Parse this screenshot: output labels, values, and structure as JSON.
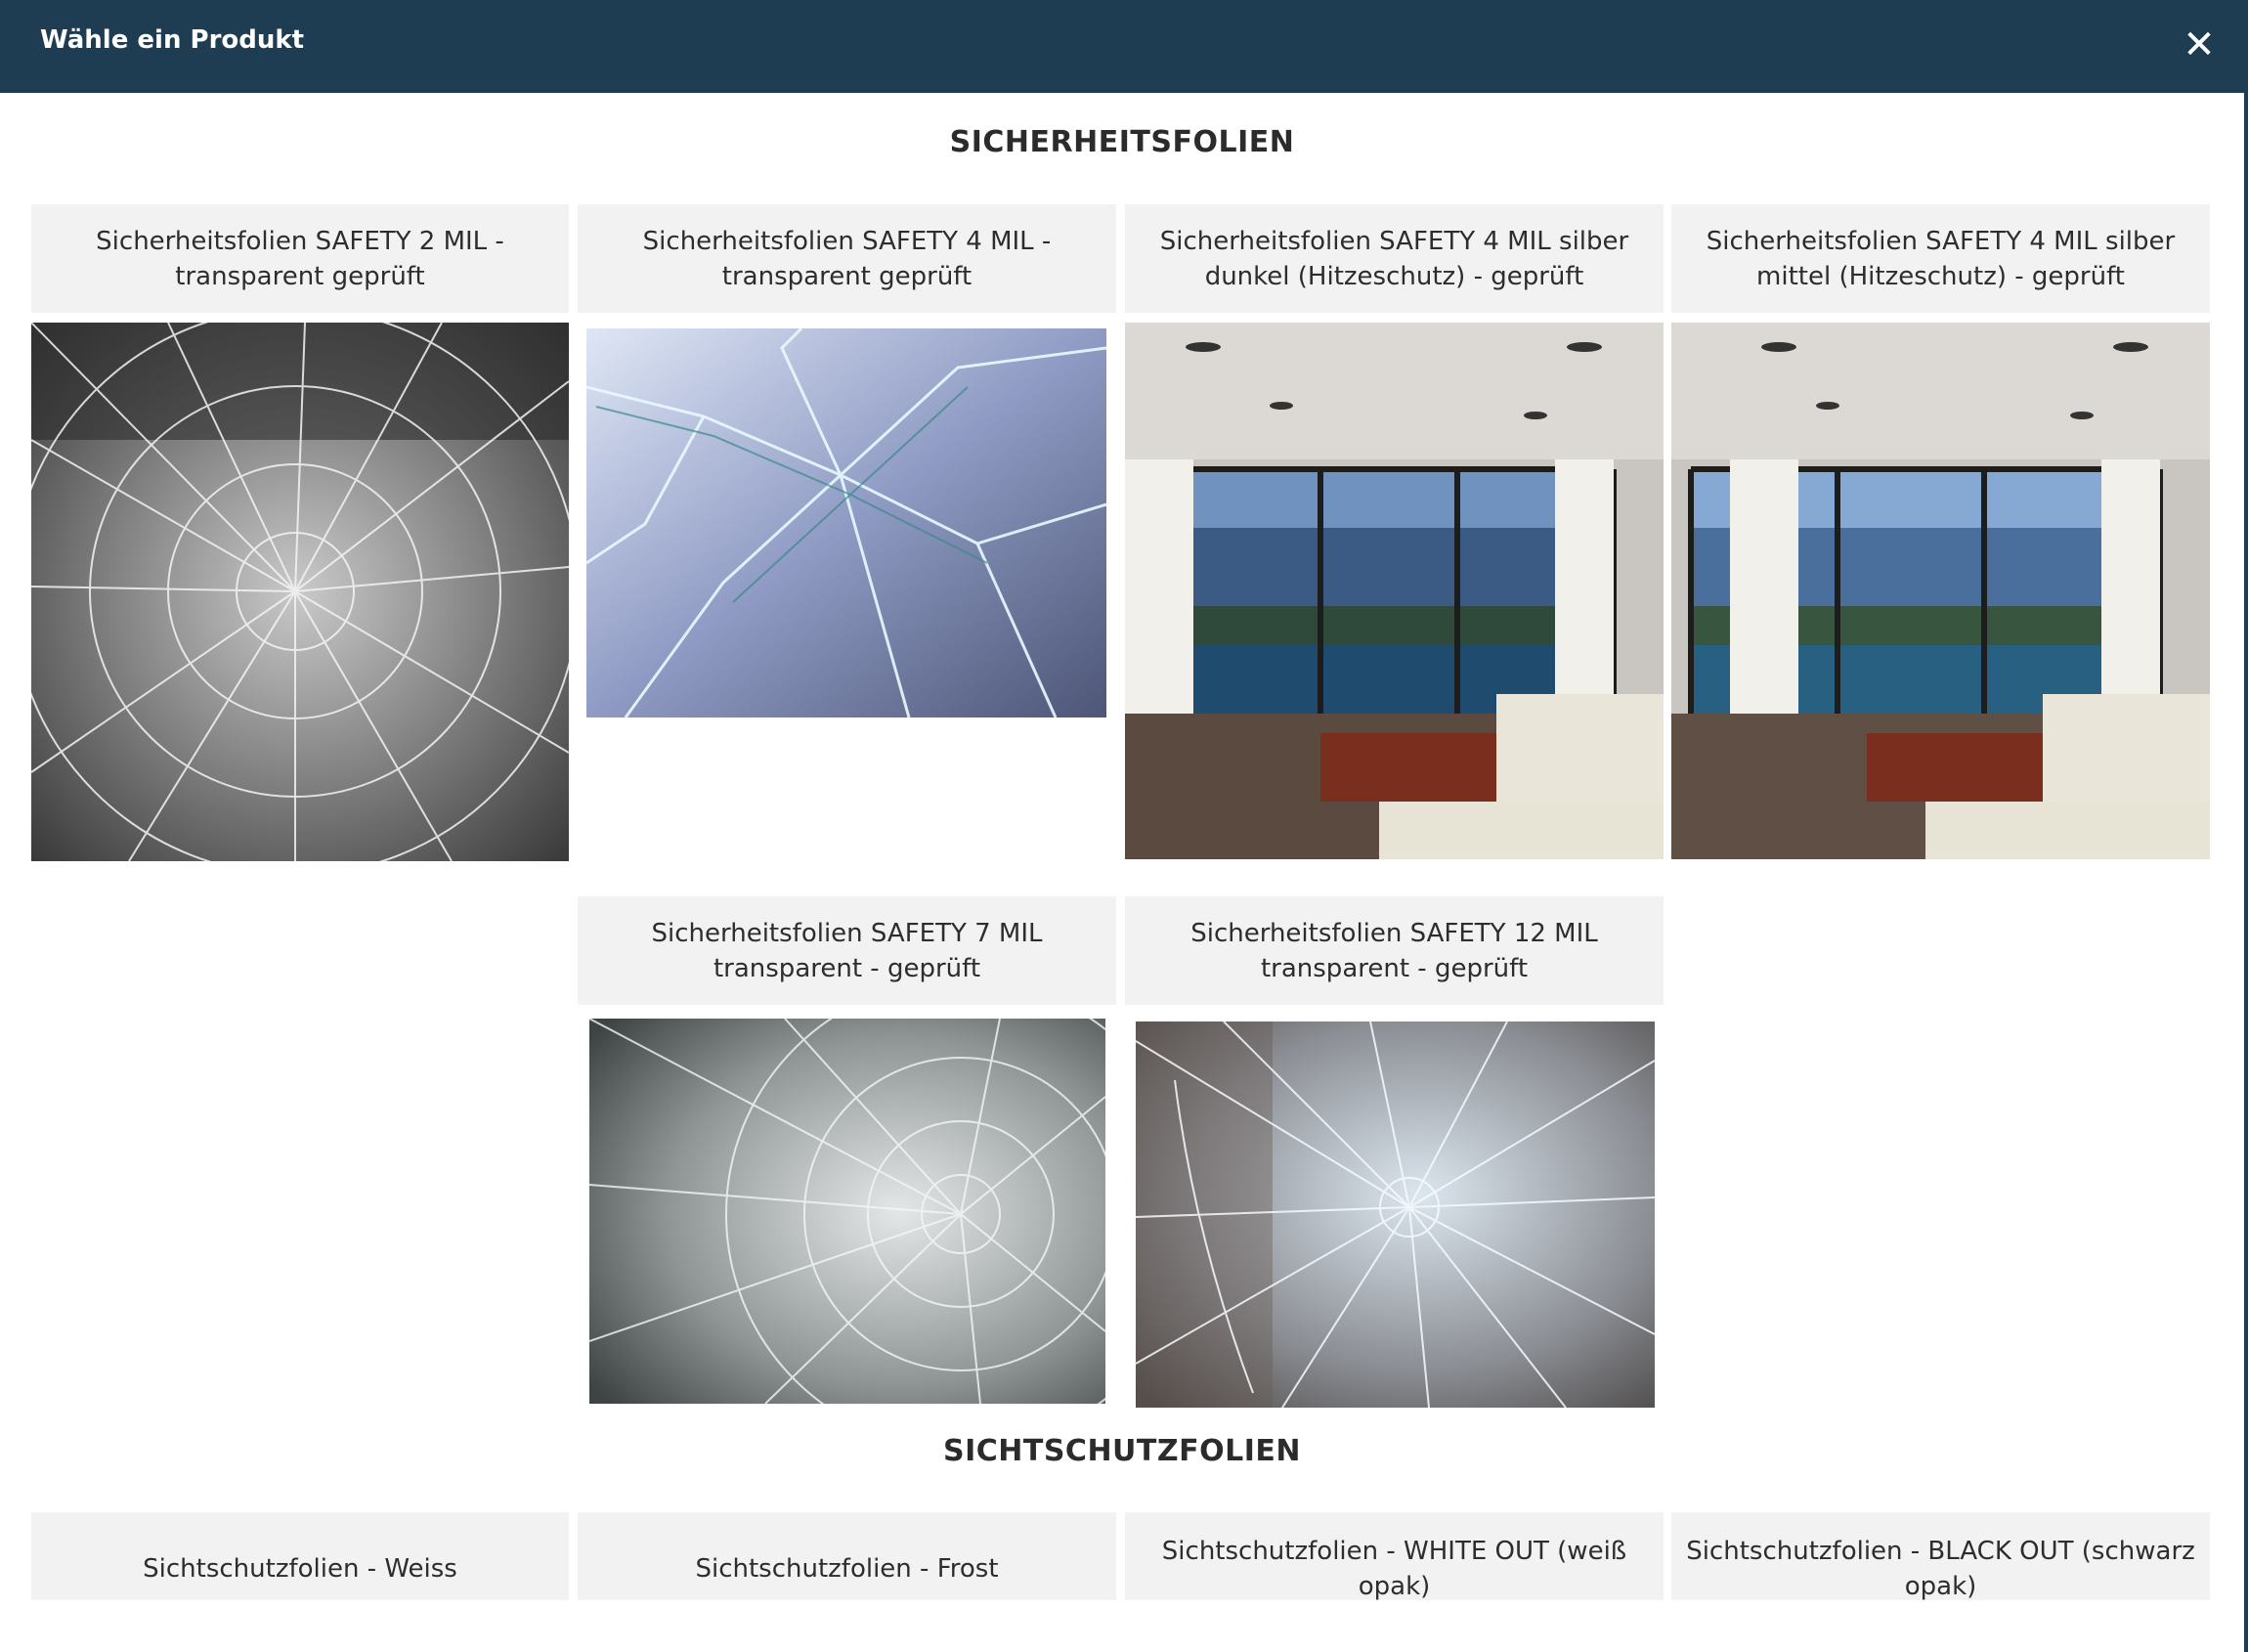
{
  "dialog": {
    "title": "Wähle ein Produkt",
    "close_label": "✕"
  },
  "sections": [
    {
      "title": "SICHERHEITSFOLIEN",
      "products": [
        {
          "label": "Sicherheitsfolien SAFETY 2 MIL - transparent geprüft",
          "image": "shattered-glass-radial"
        },
        {
          "label": "Sicherheitsfolien SAFETY 4 MIL - transparent geprüft",
          "image": "broken-glass-blue"
        },
        {
          "label": "Sicherheitsfolien SAFETY 4 MIL silber dunkel (Hitzeschutz) - geprüft",
          "image": "living-room-window"
        },
        {
          "label": "Sicherheitsfolien SAFETY 4 MIL silber mittel (Hitzeschutz) - geprüft",
          "image": "living-room-window"
        },
        {
          "label": "Sicherheitsfolien SAFETY 7 MIL transparent - geprüft",
          "image": "shattered-glass-grey"
        },
        {
          "label": "Sicherheitsfolien SAFETY 12 MIL transparent - geprüft",
          "image": "shattered-glass-impact"
        }
      ]
    },
    {
      "title": "SICHTSCHUTZFOLIEN",
      "products": [
        {
          "label": "Sichtschutzfolien - Weiss"
        },
        {
          "label": "Sichtschutzfolien - Frost"
        },
        {
          "label": "Sichtschutzfolien - WHITE OUT (weiß opak)"
        },
        {
          "label": "Sichtschutzfolien - BLACK OUT (schwarz opak)"
        }
      ]
    }
  ],
  "colors": {
    "header_bg": "#1f3d52",
    "card_bg": "#f2f2f2",
    "text": "#2d2d2d"
  }
}
